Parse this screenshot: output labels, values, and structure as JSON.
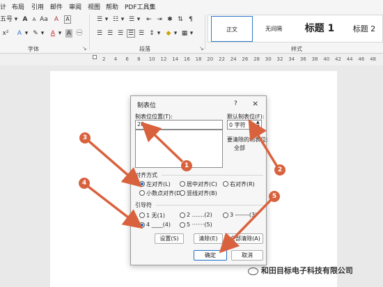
{
  "menubar": [
    "计",
    "布局",
    "引用",
    "邮件",
    "审阅",
    "视图",
    "帮助",
    "PDF工具集"
  ],
  "ribbon": {
    "font_name": "五号",
    "font_size_arrow": "A",
    "font_group_label": "字体",
    "paragraph_group_label": "段落",
    "styles_group_label": "样式",
    "styles": [
      "正文",
      "无间隔",
      "标题 1",
      "标题 2"
    ]
  },
  "ruler": [
    "2",
    "4",
    "6",
    "8",
    "10",
    "12",
    "14",
    "16",
    "18",
    "20",
    "22",
    "24",
    "26",
    "28",
    "30",
    "32",
    "34",
    "36",
    "38",
    "40",
    "42",
    "44",
    "46",
    "48"
  ],
  "dialog": {
    "title": "制表位",
    "help": "?",
    "close": "×",
    "tab_position_label": "制表位位置(T):",
    "tab_position_value": "20",
    "default_tab_label": "默认制表位(F):",
    "default_tab_value": "0 字符",
    "to_clear_label": "要清除的制表位:",
    "to_clear_value": "全部",
    "alignment_label": "对齐方式",
    "alignment_options": [
      "左对齐(L)",
      "居中对齐(C)",
      "右对齐(R)",
      "小数点对齐(D)",
      "竖线对齐(B)"
    ],
    "alignment_selected": 0,
    "leader_label": "引导符",
    "leader_options": [
      "1 无(1)",
      "2 .......(2)",
      "3 -------(3)",
      "4 ____(4)",
      "5 ·······(5)"
    ],
    "leader_selected": 3,
    "set_button": "设置(S)",
    "clear_button": "清除(E)",
    "clear_all_button": "全部清除(A)",
    "ok_button": "确定",
    "cancel_button": "取消"
  },
  "annotations": [
    "1",
    "2",
    "3",
    "4",
    "5"
  ],
  "watermark": "和田目标电子科技有限公司",
  "colors": {
    "arrow": "#d9623e",
    "accent": "#1d6fc4",
    "badge": "#d9623e"
  }
}
